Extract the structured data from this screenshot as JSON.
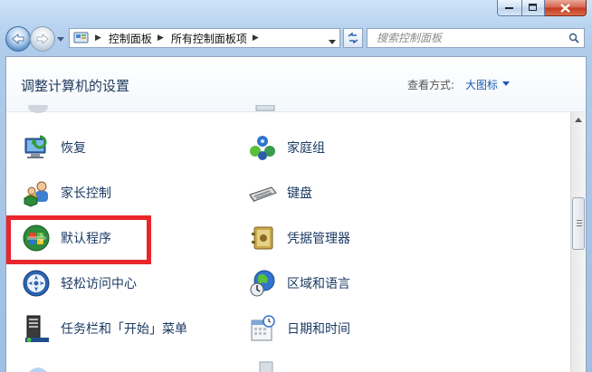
{
  "window": {
    "address": {
      "crumbs": [
        "控制面板",
        "所有控制面板项"
      ]
    },
    "search": {
      "placeholder": "搜索控制面板"
    }
  },
  "header": {
    "title": "调整计算机的设置",
    "view_label": "查看方式:",
    "view_value": "大图标"
  },
  "items": {
    "left": [
      "恢复",
      "家长控制",
      "默认程序",
      "轻松访问中心",
      "任务栏和「开始」菜单"
    ],
    "right": [
      "家庭组",
      "键盘",
      "凭据管理器",
      "区域和语言",
      "日期和时间"
    ]
  },
  "icons": {
    "left": [
      "recovery-icon",
      "parental-controls-icon",
      "default-programs-icon",
      "ease-of-access-icon",
      "taskbar-start-menu-icon"
    ],
    "right": [
      "homegroup-icon",
      "keyboard-icon",
      "credential-manager-icon",
      "region-language-icon",
      "date-time-icon"
    ]
  },
  "colors": {
    "highlight": "#e8262b",
    "link": "#1a5bb5",
    "title": "#1e395b",
    "item_label": "#1b3a63"
  }
}
